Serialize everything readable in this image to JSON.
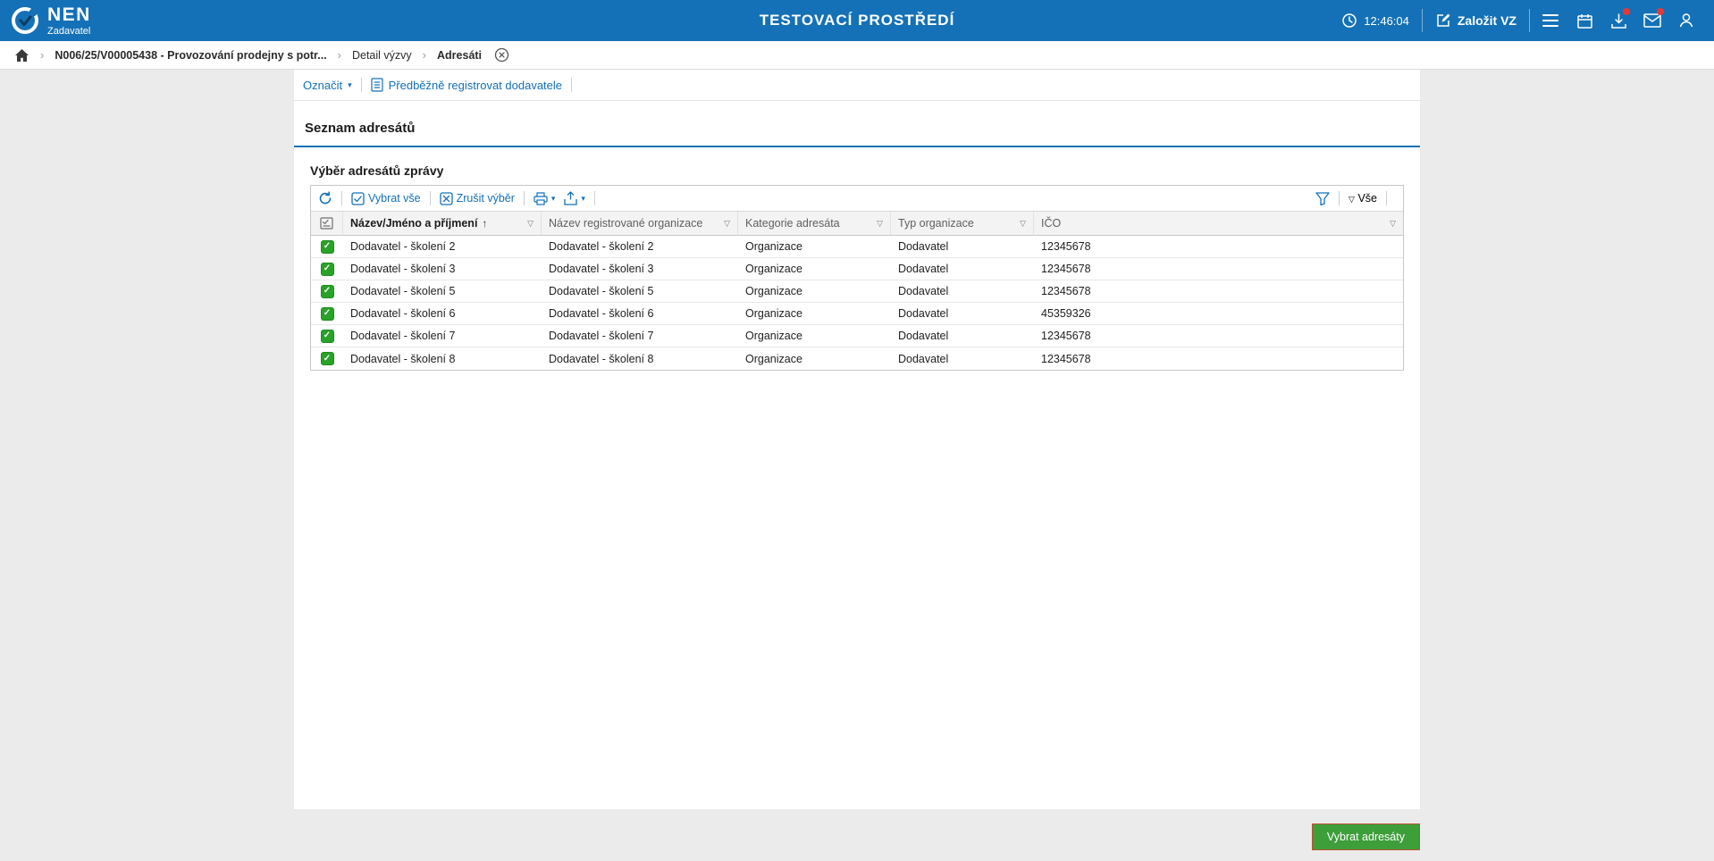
{
  "colors": {
    "brand_blue": "#1471b7",
    "link_blue": "#1471b7",
    "success_green": "#3d9e3a",
    "checkbox_green": "#28a228",
    "badge_red": "#e53935"
  },
  "icons": {
    "dropdown_filled": "▾",
    "dropdown_outline": "▽",
    "sort_ascending": "↑",
    "checkmark": "✓",
    "breadcrumb_separator": "›"
  },
  "header": {
    "brand": "NEN",
    "brand_subtitle": "Zadavatel",
    "environment": "TESTOVACÍ PROSTŘEDÍ",
    "time": "12:46:04",
    "create_button": "Založit VZ"
  },
  "breadcrumb": {
    "items": [
      "N006/25/V00005438 - Provozování prodejny s potr...",
      "Detail výzvy",
      "Adresáti"
    ]
  },
  "actions": {
    "mark_label": "Označit",
    "preregister_label": "Předběžně registrovat dodavatele"
  },
  "section": {
    "title": "Seznam adresátů",
    "subtitle": "Výběr adresátů zprávy"
  },
  "grid_toolbar": {
    "select_all_label": "Vybrat vše",
    "clear_selection_label": "Zrušit výběr",
    "scope_label": "Vše"
  },
  "table": {
    "columns": [
      "Název/Jméno a příjmení",
      "Název registrované organizace",
      "Kategorie adresáta",
      "Typ organizace",
      "IČO"
    ],
    "rows": [
      {
        "name": "Dodavatel - školení 2",
        "org": "Dodavatel - školení 2",
        "category": "Organizace",
        "type": "Dodavatel",
        "ico": "12345678"
      },
      {
        "name": "Dodavatel - školení 3",
        "org": "Dodavatel - školení 3",
        "category": "Organizace",
        "type": "Dodavatel",
        "ico": "12345678"
      },
      {
        "name": "Dodavatel - školení 5",
        "org": "Dodavatel - školení 5",
        "category": "Organizace",
        "type": "Dodavatel",
        "ico": "12345678"
      },
      {
        "name": "Dodavatel - školení 6",
        "org": "Dodavatel - školení 6",
        "category": "Organizace",
        "type": "Dodavatel",
        "ico": "45359326"
      },
      {
        "name": "Dodavatel - školení 7",
        "org": "Dodavatel - školení 7",
        "category": "Organizace",
        "type": "Dodavatel",
        "ico": "12345678"
      },
      {
        "name": "Dodavatel - školení 8",
        "org": "Dodavatel - školení 8",
        "category": "Organizace",
        "type": "Dodavatel",
        "ico": "12345678"
      }
    ]
  },
  "footer": {
    "select_button": "Vybrat adresáty"
  }
}
